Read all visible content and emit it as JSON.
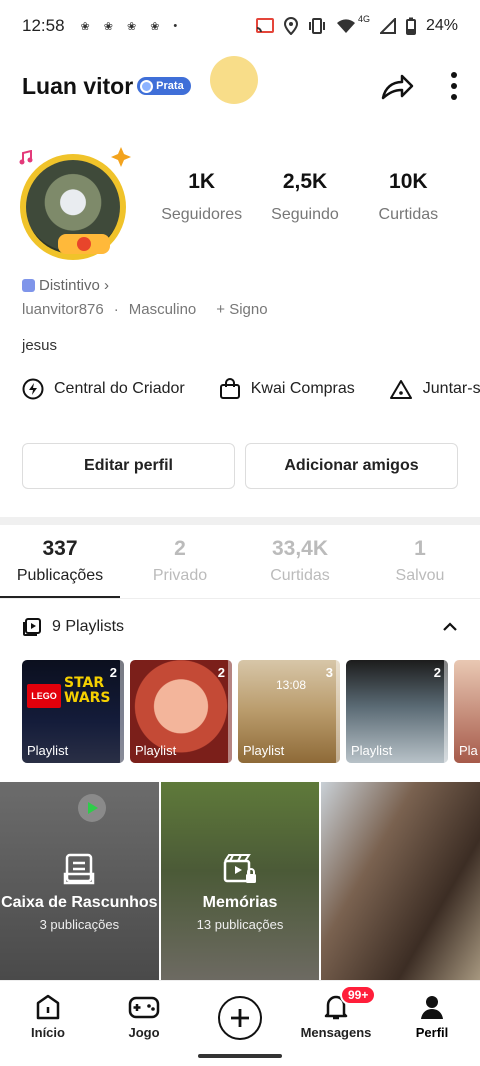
{
  "status_bar": {
    "time": "12:58",
    "network": "4G",
    "battery": "24%"
  },
  "profile": {
    "name": "Luan vitor",
    "badge_label": "Prata",
    "stats": [
      {
        "value": "1K",
        "label": "Seguidores"
      },
      {
        "value": "2,5K",
        "label": "Seguindo"
      },
      {
        "value": "10K",
        "label": "Curtidas"
      }
    ],
    "distintivo": "Distintivo ›",
    "username": "luanvitor876",
    "gender": "Masculino",
    "sign": "+ Signo",
    "bio": "jesus"
  },
  "shortcuts": [
    {
      "label": "Central do Criador",
      "icon": "lightning-icon"
    },
    {
      "label": "Kwai Compras",
      "icon": "shopping-bag-icon"
    },
    {
      "label": "Juntar-s",
      "icon": "tent-icon"
    }
  ],
  "buttons": {
    "edit": "Editar perfil",
    "add_friends": "Adicionar amigos"
  },
  "tabs": [
    {
      "value": "337",
      "label": "Publicações",
      "active": true
    },
    {
      "value": "2",
      "label": "Privado"
    },
    {
      "value": "33,4K",
      "label": "Curtidas"
    },
    {
      "value": "1",
      "label": "Salvou"
    }
  ],
  "playlists": {
    "header": "9 Playlists",
    "items": [
      {
        "count": "2",
        "label": "Playlist",
        "logo_text": "LEGO",
        "title_text": "STAR WARS"
      },
      {
        "count": "2",
        "label": "Playlist"
      },
      {
        "count": "3",
        "label": "Playlist",
        "clock": "13:08"
      },
      {
        "count": "2",
        "label": "Playlist"
      },
      {
        "label": "Pla"
      }
    ]
  },
  "grid": [
    {
      "title": "Caixa de Rascunhos",
      "subtitle": "3 publicações"
    },
    {
      "title": "Memórias",
      "subtitle": "13 publicações"
    },
    {
      "title": "",
      "subtitle": ""
    }
  ],
  "bottom_nav": [
    {
      "label": "Início",
      "icon": "home-icon"
    },
    {
      "label": "Jogo",
      "icon": "gamepad-icon"
    },
    {
      "label": "",
      "icon": "plus-icon"
    },
    {
      "label": "Mensagens",
      "icon": "bell-icon",
      "badge": "99+"
    },
    {
      "label": "Perfil",
      "icon": "person-icon",
      "active": true
    }
  ]
}
